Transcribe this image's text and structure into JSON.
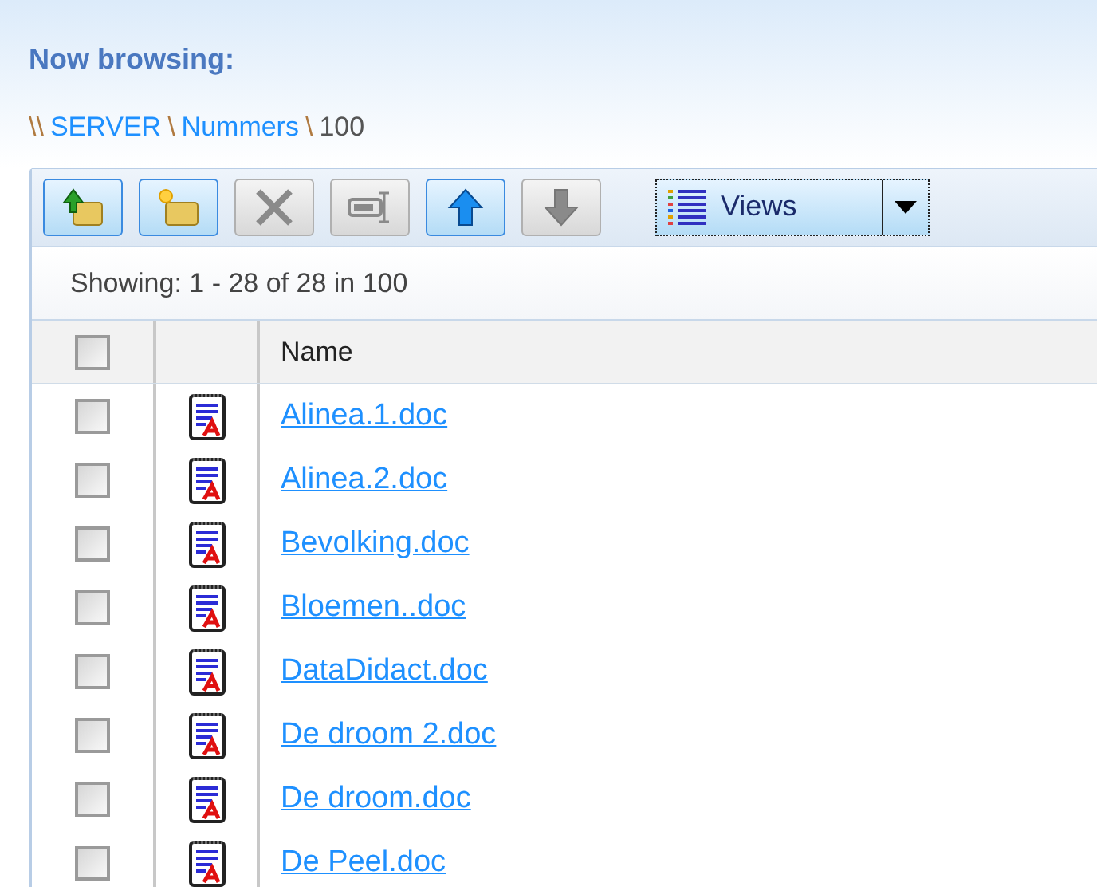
{
  "header": {
    "title": "Now browsing:"
  },
  "breadcrumb": [
    {
      "kind": "separator",
      "text": "\\\\"
    },
    {
      "kind": "link",
      "text": "SERVER"
    },
    {
      "kind": "separator",
      "text": "\\"
    },
    {
      "kind": "link",
      "text": "Nummers"
    },
    {
      "kind": "separator",
      "text": "\\"
    },
    {
      "kind": "current",
      "text": "100"
    }
  ],
  "toolbar": {
    "buttons": [
      {
        "kind": "up-folder",
        "disabled": false
      },
      {
        "kind": "new-folder",
        "disabled": false
      },
      {
        "kind": "delete",
        "disabled": true
      },
      {
        "kind": "rename",
        "disabled": true
      },
      {
        "kind": "move-up",
        "disabled": false
      },
      {
        "kind": "move-down",
        "disabled": true
      }
    ],
    "views": {
      "label": "Views"
    }
  },
  "status": "Showing: 1 - 28 of 28 in 100",
  "table": {
    "columns": [
      {
        "kind": "check",
        "checked": false
      },
      {
        "kind": "icon"
      },
      {
        "kind": "text",
        "label": "Name"
      }
    ],
    "rows": [
      {
        "name": "Alinea.1.doc",
        "checked": false
      },
      {
        "name": "Alinea.2.doc",
        "checked": false
      },
      {
        "name": "Bevolking.doc",
        "checked": false
      },
      {
        "name": "Bloemen..doc",
        "checked": false
      },
      {
        "name": "DataDidact.doc",
        "checked": false
      },
      {
        "name": "De droom 2.doc",
        "checked": false
      },
      {
        "name": "De droom.doc",
        "checked": false
      },
      {
        "name": "De Peel.doc",
        "checked": false
      }
    ]
  }
}
